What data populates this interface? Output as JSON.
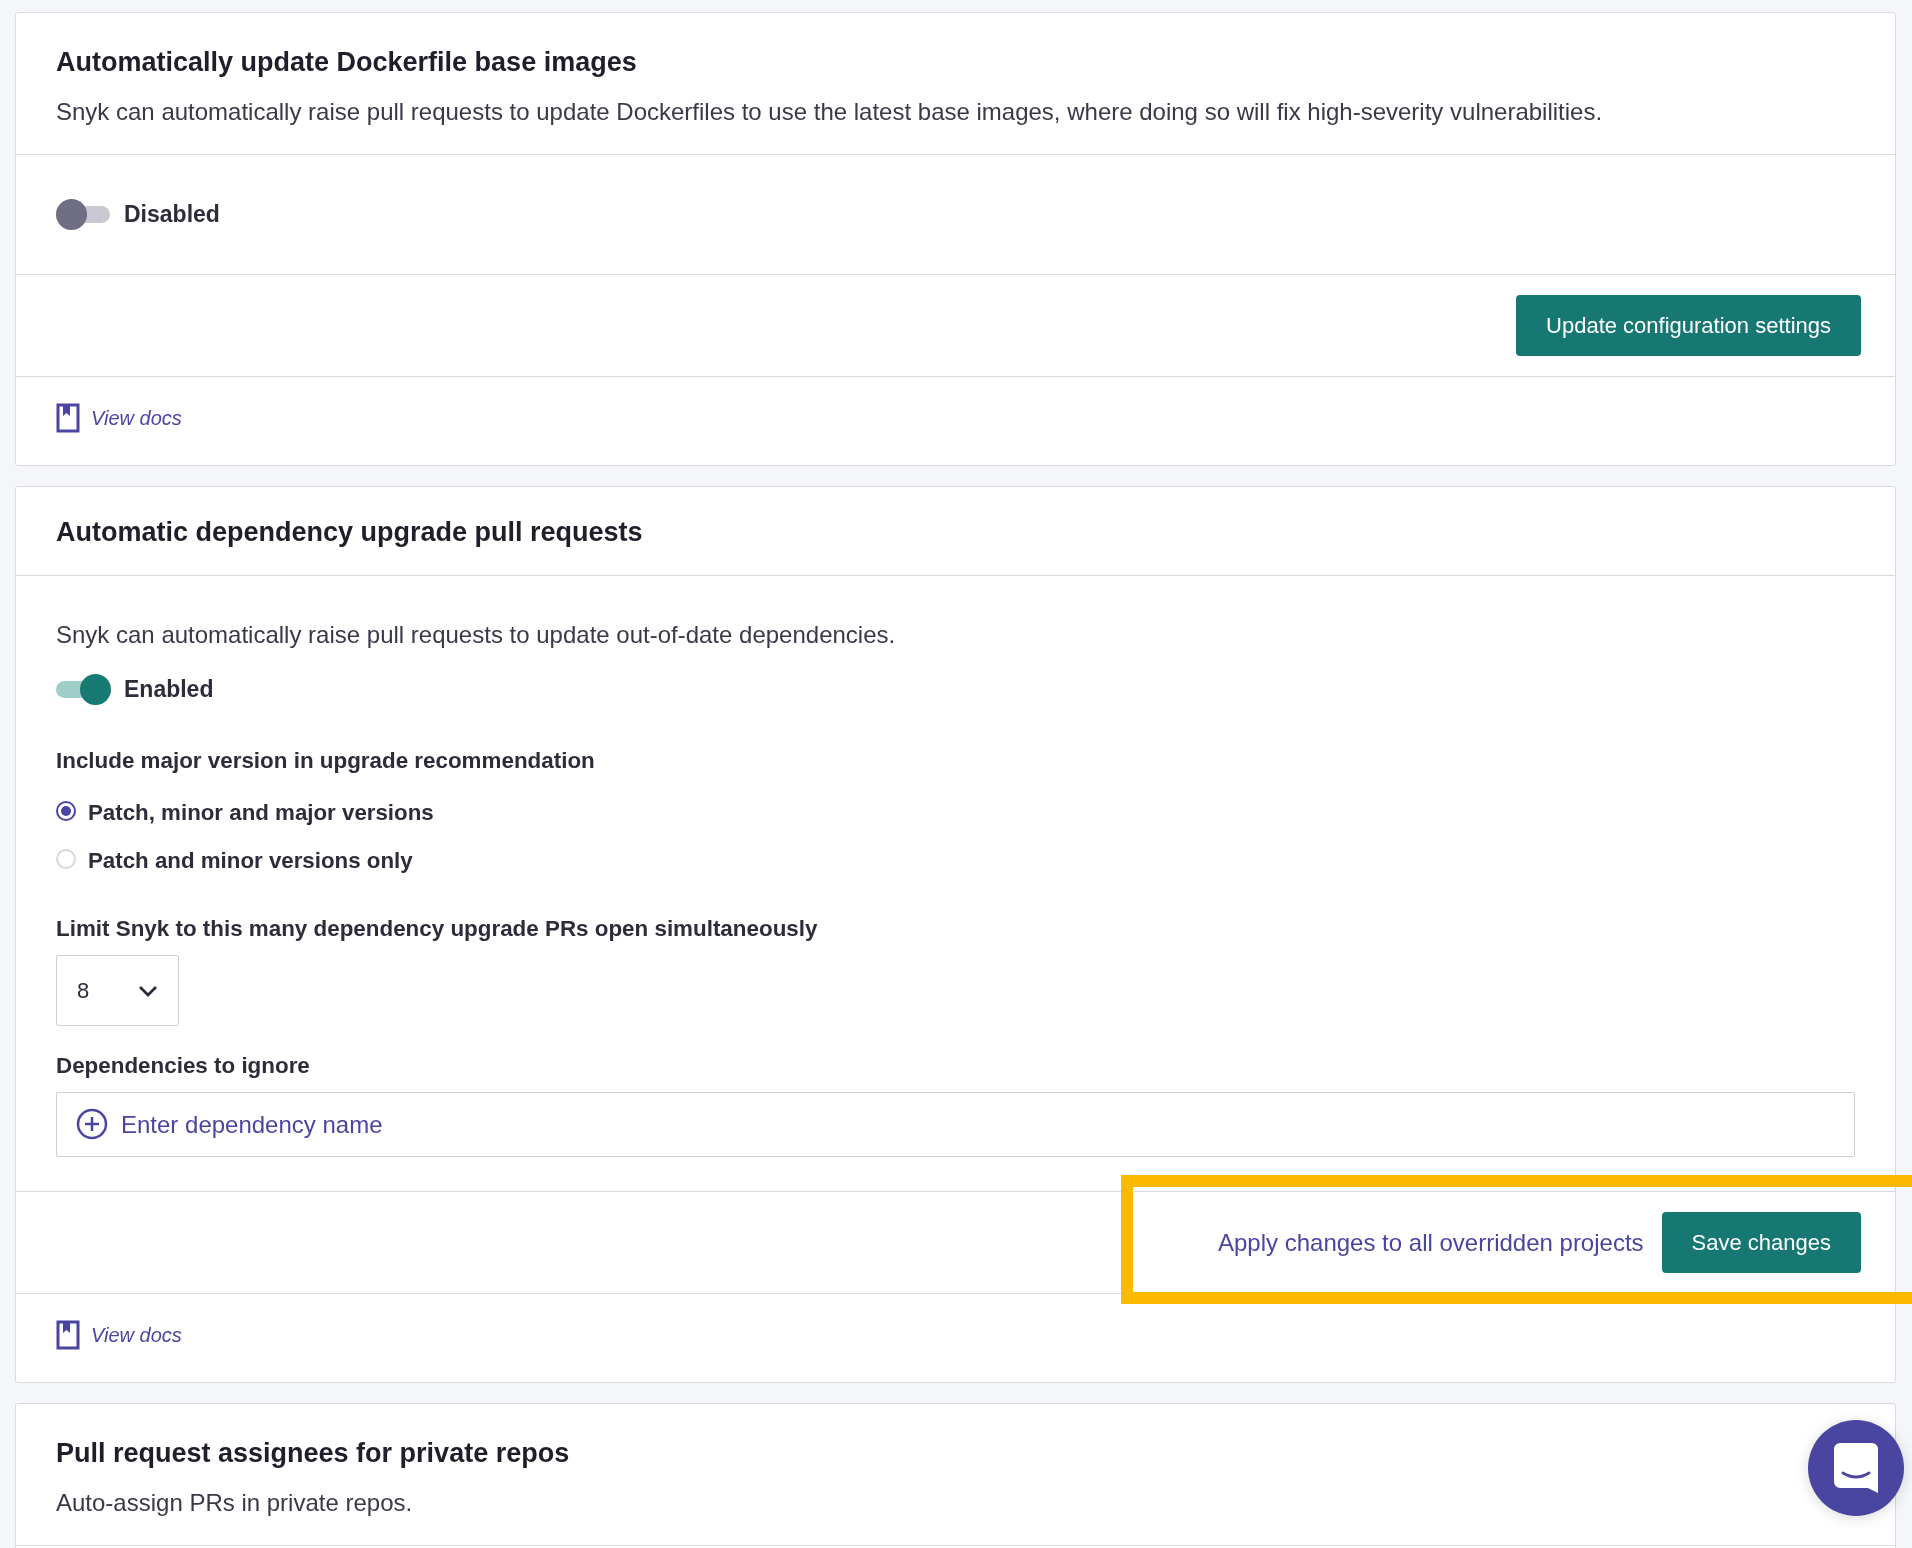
{
  "cards": [
    {
      "title": "Automatically update Dockerfile base images",
      "description": "Snyk can automatically raise pull requests to update Dockerfiles to use the latest base images, where doing so will fix high-severity vulnerabilities.",
      "sections": [
        {
          "items": [
            {
              "kind": "toggle",
              "label": "Disabled",
              "on": false
            }
          ]
        },
        {
          "items": [
            {
              "kind": "actions",
              "buttons": [
                {
                  "label": "Update configuration settings",
                  "kind": "button"
                }
              ]
            }
          ]
        },
        {
          "items": [
            {
              "kind": "docs",
              "label": "View docs"
            }
          ]
        }
      ]
    },
    {
      "title": "Automatic dependency upgrade pull requests",
      "sections": [
        {
          "items": [
            {
              "kind": "description",
              "text": "Snyk can automatically raise pull requests to update out-of-date dependencies."
            },
            {
              "kind": "toggle",
              "label": "Enabled",
              "on": true
            },
            {
              "kind": "radio_group",
              "label": "Include major version in upgrade recommendation",
              "options": [
                {
                  "label": "Patch, minor and major versions",
                  "selected": true
                },
                {
                  "label": "Patch and minor versions only",
                  "selected": false
                }
              ]
            },
            {
              "kind": "select",
              "label": "Limit Snyk to this many dependency upgrade PRs open simultaneously",
              "value": "8"
            },
            {
              "kind": "tag_input",
              "label": "Dependencies to ignore",
              "placeholder": "Enter dependency name"
            }
          ]
        },
        {
          "highlighted": true,
          "items": [
            {
              "kind": "actions",
              "buttons": [
                {
                  "label": "Apply changes to all overridden projects",
                  "kind": "link"
                },
                {
                  "label": "Save changes",
                  "kind": "button"
                }
              ]
            }
          ]
        },
        {
          "items": [
            {
              "kind": "docs",
              "label": "View docs"
            }
          ]
        }
      ]
    },
    {
      "title": "Pull request assignees for private repos",
      "description": "Auto-assign PRs in private repos."
    }
  ]
}
